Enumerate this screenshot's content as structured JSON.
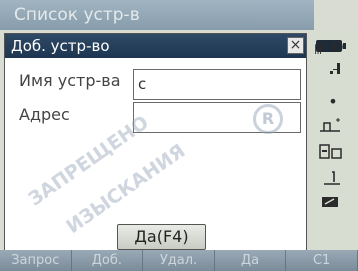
{
  "background_window": {
    "title": "Список устр-в",
    "softkeys": [
      "Запрос",
      "Доб.",
      "Удал.",
      "Да",
      "С1"
    ]
  },
  "status": {
    "battery_icon": "battery-full-icon",
    "items": [
      "O",
      "",
      "",
      "",
      "",
      "",
      "",
      ""
    ]
  },
  "dialog": {
    "title": "Доб. устр-во",
    "close_label": "×",
    "device_name_label": "Имя устр-ва",
    "device_name_value": "c",
    "address_label": "Адрес",
    "address_value": "",
    "ok_label": "Да(F4)"
  },
  "watermark": {
    "line1": "ЗАПРЕЩЕНО",
    "line2": "ИЗЫСКАНИЯ",
    "mark": "R"
  }
}
